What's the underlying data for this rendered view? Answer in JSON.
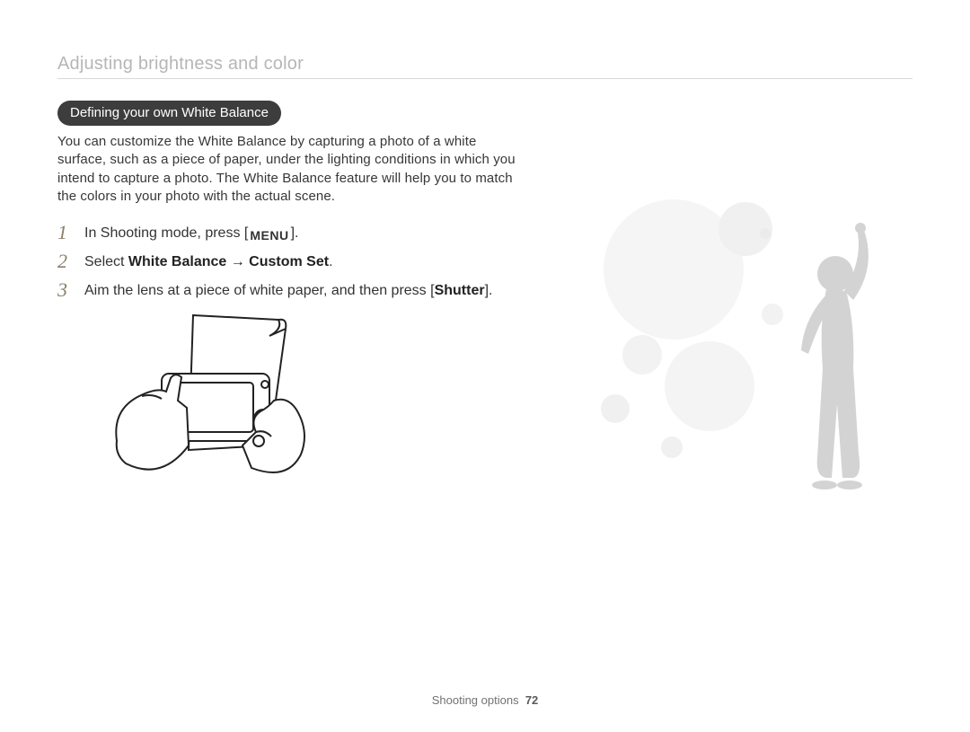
{
  "section_title": "Adjusting brightness and color",
  "pill_heading": "Defining your own White Balance",
  "intro": "You can customize the White Balance by capturing a photo of a white surface, such as a piece of paper, under the lighting conditions in which you intend to capture a photo. The White Balance feature will help you to match the colors in your photo with the actual scene.",
  "steps": [
    {
      "num": "1",
      "pre": "In Shooting mode, press [",
      "menu": "MENU",
      "post": "]."
    },
    {
      "num": "2",
      "pre": "Select ",
      "bold": "White Balance → Custom Set",
      "post": "."
    },
    {
      "num": "3",
      "pre": "Aim the lens at a piece of white paper, and then press [",
      "bold": "Shutter",
      "post": "]."
    }
  ],
  "footer": {
    "label": "Shooting options",
    "page": "72"
  }
}
